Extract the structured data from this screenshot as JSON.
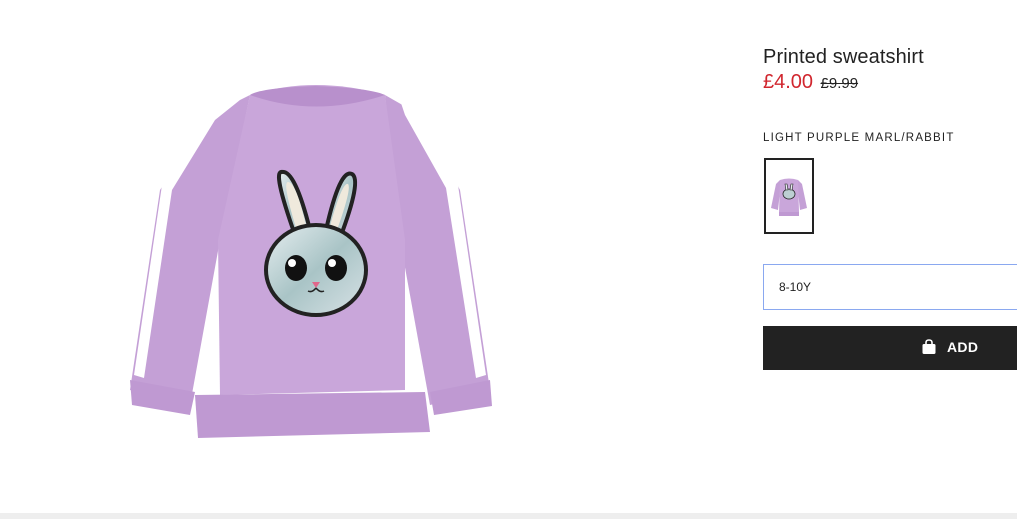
{
  "product": {
    "title": "Printed sweatshirt",
    "price_sale": "£4.00",
    "price_original": "£9.99",
    "color_name": "LIGHT PURPLE MARL/RABBIT",
    "selected_size": "8-10Y",
    "add_label": "ADD"
  },
  "colors": {
    "sale_price": "#d1262e",
    "button_bg": "#222222",
    "select_border": "#8aa8f0",
    "garment": "#c7a2da"
  },
  "icons": {
    "bag": "shopping-bag-icon"
  }
}
